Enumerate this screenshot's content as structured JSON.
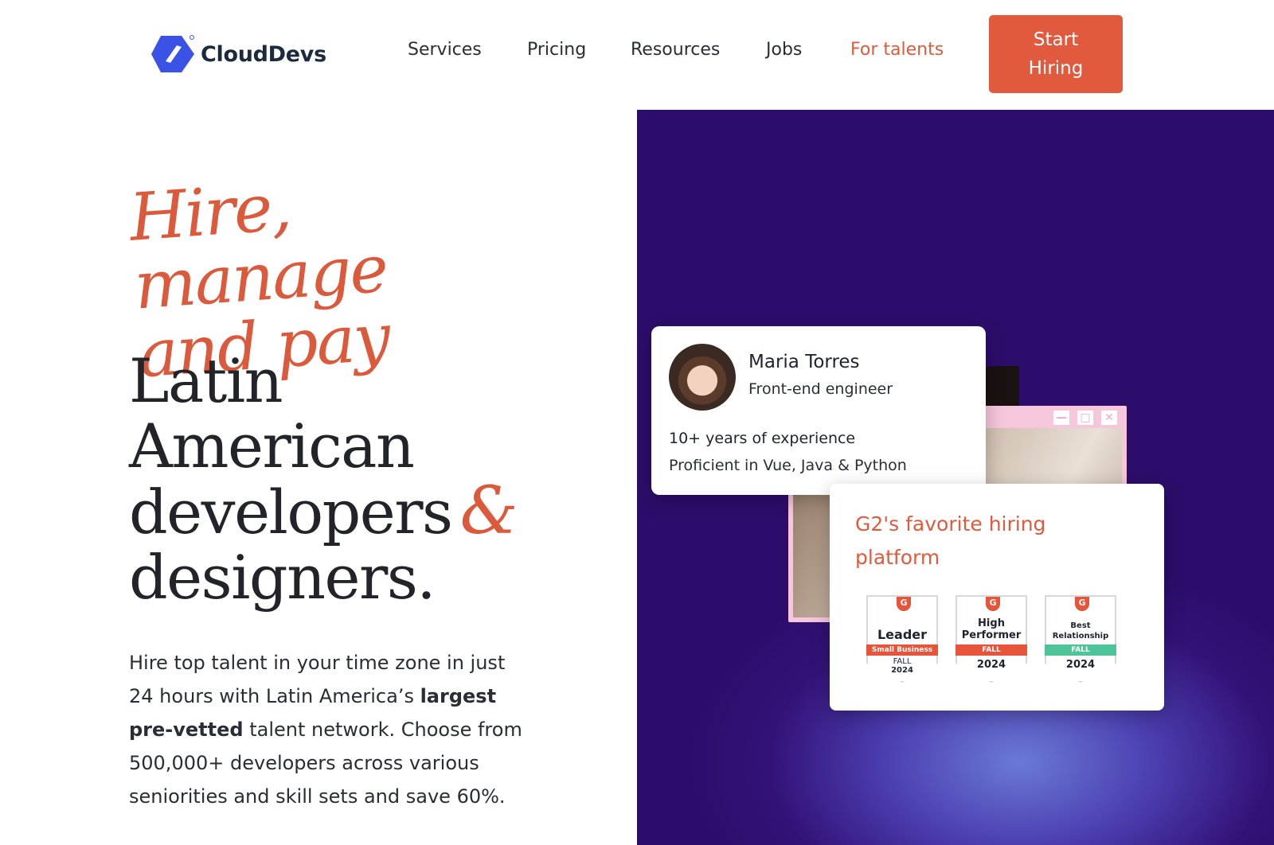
{
  "header": {
    "logo_text": "CloudDevs",
    "nav": [
      {
        "label": "Services"
      },
      {
        "label": "Pricing"
      },
      {
        "label": "Resources"
      },
      {
        "label": "Jobs"
      },
      {
        "label": "For talents"
      }
    ],
    "cta_label": "Start Hiring"
  },
  "hero": {
    "script_line1": "Hire, manage",
    "script_line2": "and pay",
    "headline_line1": "Latin",
    "headline_line2": "American",
    "headline_line3": "developers",
    "headline_amp": "&",
    "headline_line4": "designers.",
    "desc_part1": "Hire top talent in your time zone in just 24 hours with Latin America’s ",
    "desc_bold": "largest pre-vetted",
    "desc_part2": " talent network. Choose from 500,000+ developers across various seniorities and skill sets and save 60%."
  },
  "profile_card": {
    "name": "Maria Torres",
    "role": "Front-end engineer",
    "experience": "10+ years of experience",
    "skills": "Proficient in Vue, Java & Python"
  },
  "window_controls": [
    "—",
    "□",
    "✕"
  ],
  "g2_card": {
    "title": "G2's favorite hiring platform",
    "badges": [
      {
        "g2": "G",
        "title": "Leader",
        "band": "Small Business",
        "season": "FALL",
        "year": "2024",
        "band_color": "#e8543a"
      },
      {
        "g2": "G",
        "title_line1": "High",
        "title_line2": "Performer",
        "band": "FALL",
        "year": "2024",
        "band_color": "#e8543a"
      },
      {
        "g2": "G",
        "title_line1": "Best",
        "title_line2": "Relationship",
        "band": "FALL",
        "year": "2024",
        "band_color": "#4ec49a"
      }
    ]
  },
  "colors": {
    "accent": "#e25a3e",
    "hero_purple": "#2c0d6b",
    "text_dark": "#23232a"
  }
}
